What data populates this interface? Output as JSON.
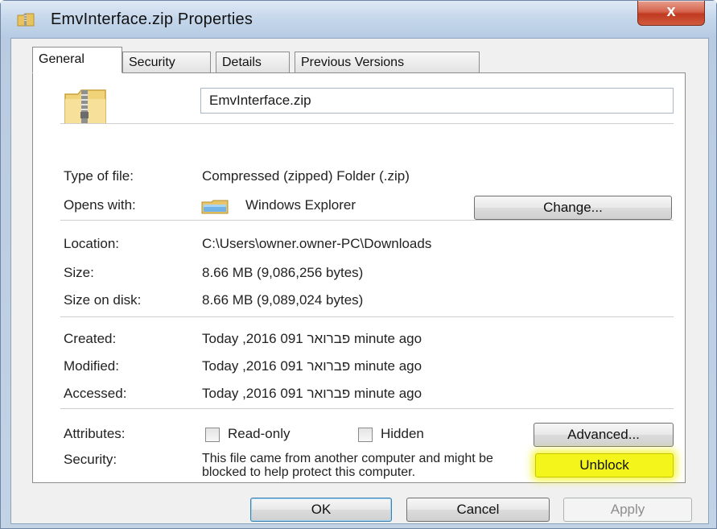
{
  "window": {
    "title": "EmvInterface.zip Properties",
    "close_glyph": "x"
  },
  "tabs": [
    {
      "label": "General",
      "active": true
    },
    {
      "label": "Security",
      "active": false
    },
    {
      "label": "Details",
      "active": false
    },
    {
      "label": "Previous Versions",
      "active": false
    }
  ],
  "general": {
    "file_name": "EmvInterface.zip",
    "type_label": "Type of file:",
    "type_value": "Compressed (zipped) Folder (.zip)",
    "opens_label": "Opens with:",
    "opens_value": "Windows Explorer",
    "change_button": "Change...",
    "location_label": "Location:",
    "location_value": "C:\\Users\\owner.owner-PC\\Downloads",
    "size_label": "Size:",
    "size_value": "8.66 MB (9,086,256 bytes)",
    "size_disk_label": "Size on disk:",
    "size_disk_value": "8.66 MB (9,089,024 bytes)",
    "created_label": "Created:",
    "created_value": "Today  ,2016 פברואר 091 minute ago",
    "modified_label": "Modified:",
    "modified_value": "Today  ,2016 פברואר 091 minute ago",
    "accessed_label": "Accessed:",
    "accessed_value": "Today  ,2016 פברואר 091 minute ago",
    "attributes_label": "Attributes:",
    "readonly_label": "Read-only",
    "readonly_checked": false,
    "hidden_label": "Hidden",
    "hidden_checked": false,
    "advanced_button": "Advanced...",
    "security_label": "Security:",
    "security_text": "This file came from another computer and might be blocked to help protect this computer.",
    "unblock_button": "Unblock",
    "highlight_color": "#f4f51a"
  },
  "footer": {
    "ok": "OK",
    "cancel": "Cancel",
    "apply": "Apply"
  },
  "icons": {
    "title": "zip-folder-icon",
    "file": "zip-folder-icon",
    "opens_with": "windows-explorer-icon"
  }
}
